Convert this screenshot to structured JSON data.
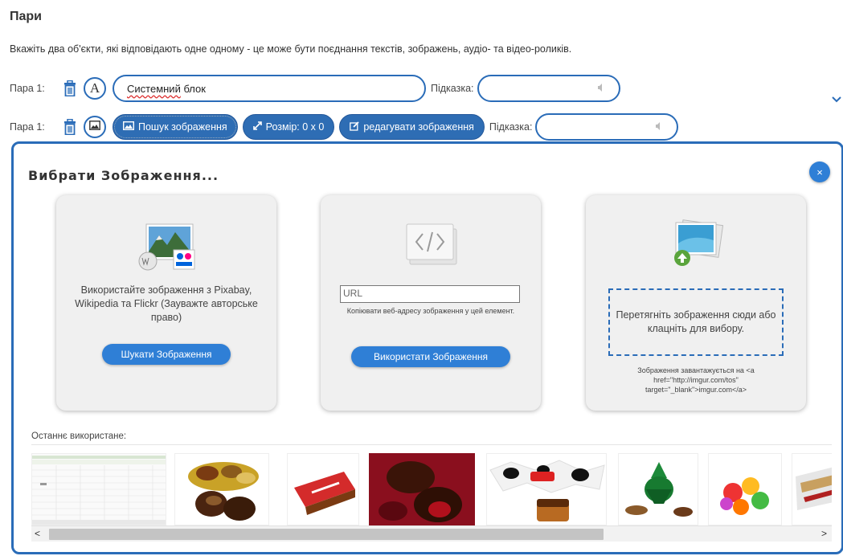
{
  "section": {
    "title": "Пари",
    "description": "Вкажіть два об'єкти, які відповідають одне одному - це може бути поєднання текстів, зображень, аудіо- та відео-роликів."
  },
  "pair1": {
    "label": "Пара 1:",
    "mode_glyph": "A",
    "text_value": "Системний блок",
    "text_value_underlined": "Системний",
    "text_value_rest": " блок",
    "hint_label": "Підказка:"
  },
  "pair2": {
    "label": "Пара 1:",
    "search_label": "Пошук зображення",
    "size_label": "Розмір: 0 x 0",
    "edit_label": "редагувати зображення",
    "hint_label": "Підказка:"
  },
  "modal": {
    "title": "Вибрати Зображення...",
    "close_glyph": "×",
    "card_search": {
      "text": "Використайте зображення з Pixabay, Wikipedia та Flickr (Зауважте авторське право)",
      "button": "Шукати Зображення"
    },
    "card_url": {
      "placeholder": "URL",
      "hint": "Копіювати веб-адресу зображення у цей елемент.",
      "button": "Використати Зображення"
    },
    "card_upload": {
      "dropzone": "Перетягніть зображення сюди або клацніть для вибору.",
      "note": "Зображення завантажується на <a href=\"http://imgur.com/tos\" target=\"_blank\">imgur.com</a>"
    },
    "recent_label": "Останнє використане:",
    "scroll_left": "<",
    "scroll_right": ">"
  },
  "colors": {
    "accent": "#2a6cb8",
    "button": "#2f7fd6",
    "card_bg": "#f0f0f0"
  }
}
